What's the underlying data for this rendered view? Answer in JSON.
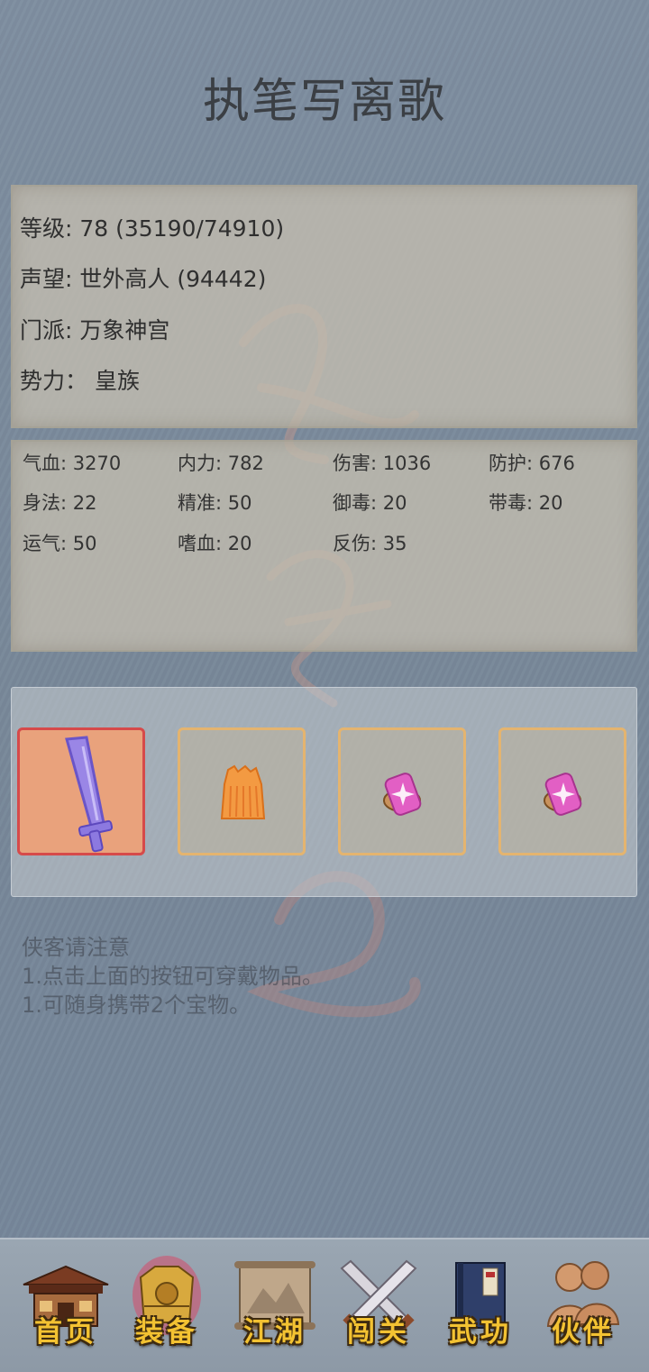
{
  "title": "执笔写离歌",
  "info": {
    "level": "等级: 78 (35190/74910)",
    "fame": "声望: 世外高人 (94442)",
    "sect": "门派: 万象神宫",
    "faction": "势力：  皇族"
  },
  "stats": [
    {
      "text": "气血: 3270"
    },
    {
      "text": "内力: 782"
    },
    {
      "text": "伤害: 1036"
    },
    {
      "text": "防护: 676"
    },
    {
      "text": "身法: 22"
    },
    {
      "text": "精准: 50"
    },
    {
      "text": "御毒: 20"
    },
    {
      "text": "带毒: 20"
    },
    {
      "text": "运气: 50"
    },
    {
      "text": "嗜血: 20"
    },
    {
      "text": "反伤: 35"
    }
  ],
  "equipment": [
    {
      "icon": "sword-icon",
      "selected": true
    },
    {
      "icon": "armor-skirt-icon",
      "selected": false
    },
    {
      "icon": "pink-treasure-icon",
      "selected": false
    },
    {
      "icon": "pink-treasure-icon",
      "selected": false
    }
  ],
  "notice": {
    "heading": "侠客请注意",
    "line1": "1.点击上面的按钮可穿戴物品。",
    "line2": "1.可随身携带2个宝物。"
  },
  "nav": [
    {
      "label": "首页",
      "icon": "house-icon"
    },
    {
      "label": "装备",
      "icon": "armor-icon"
    },
    {
      "label": "江湖",
      "icon": "scroll-map-icon"
    },
    {
      "label": "闯关",
      "icon": "crossed-swords-icon"
    },
    {
      "label": "武功",
      "icon": "book-icon"
    },
    {
      "label": "伙伴",
      "icon": "companions-icon"
    }
  ],
  "colors": {
    "nav_label": "#f3c232",
    "selected_slot_border": "#d64a4a",
    "slot_border": "#e4b46f"
  }
}
